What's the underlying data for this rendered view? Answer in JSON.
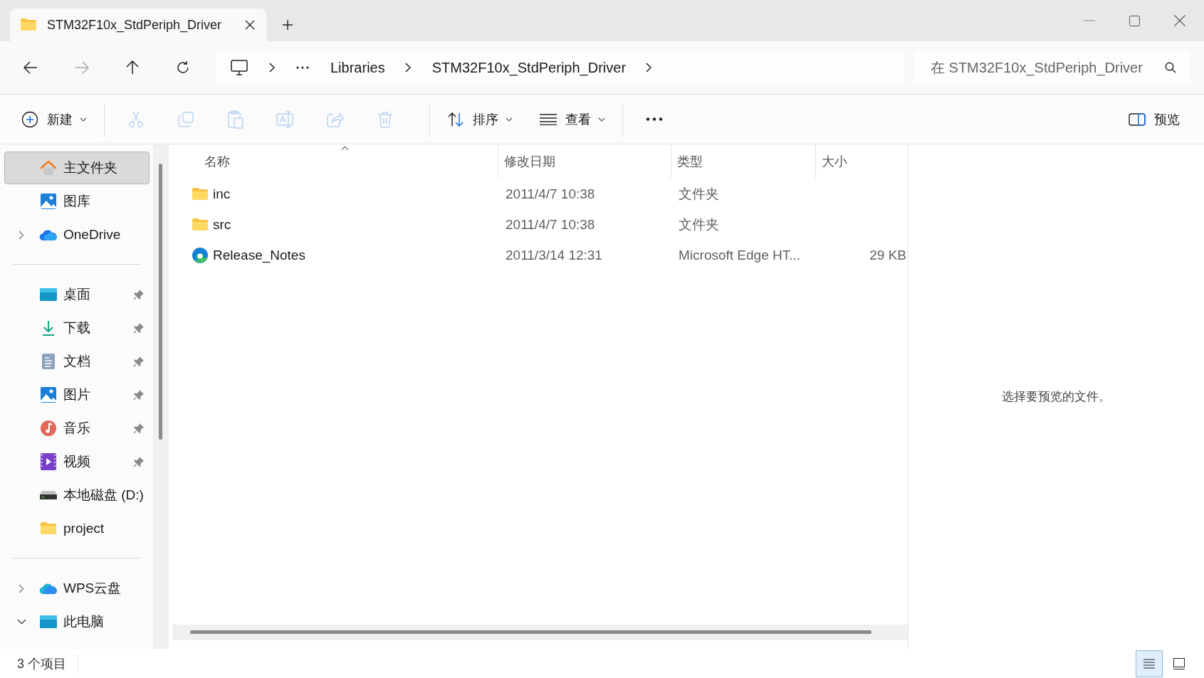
{
  "tabs": [
    {
      "title": "STM32F10x_StdPeriph_Driver",
      "selected": true
    }
  ],
  "address": {
    "segments": [
      "Libraries",
      "STM32F10x_StdPeriph_Driver"
    ]
  },
  "search": {
    "placeholder": "在 STM32F10x_StdPeriph_Driver"
  },
  "toolbar": [
    {
      "kind": "new",
      "label": "新建",
      "disabled": false
    },
    {
      "kind": "cut",
      "disabled": true
    },
    {
      "kind": "copy",
      "disabled": true
    },
    {
      "kind": "paste",
      "disabled": true
    },
    {
      "kind": "rename",
      "disabled": true
    },
    {
      "kind": "share",
      "disabled": true
    },
    {
      "kind": "delete",
      "disabled": true
    },
    {
      "kind": "sort",
      "label": "排序",
      "disabled": false
    },
    {
      "kind": "view",
      "label": "查看",
      "disabled": false
    },
    {
      "kind": "more",
      "disabled": false
    }
  ],
  "preview_button": {
    "label": "预览"
  },
  "sidebar": {
    "groups": [
      [
        {
          "label": "主文件夹",
          "kind": "home",
          "selected": true
        },
        {
          "label": "图库",
          "kind": "gallery",
          "selected": false
        },
        {
          "label": "OneDrive",
          "kind": "cloud",
          "selected": false,
          "expanded": false
        }
      ],
      [
        {
          "label": "桌面",
          "kind": "desktop",
          "selected": false,
          "pinned": true
        },
        {
          "label": "下载",
          "kind": "download",
          "selected": false,
          "pinned": true
        },
        {
          "label": "文档",
          "kind": "document",
          "selected": false,
          "pinned": true
        },
        {
          "label": "图片",
          "kind": "gallery",
          "selected": false,
          "pinned": true
        },
        {
          "label": "音乐",
          "kind": "music",
          "selected": false,
          "pinned": true
        },
        {
          "label": "视频",
          "kind": "video",
          "selected": false,
          "pinned": true
        },
        {
          "label": "本地磁盘 (D:)",
          "kind": "drive",
          "selected": false,
          "pinned": false
        },
        {
          "label": "project",
          "kind": "folder",
          "selected": false,
          "pinned": false
        }
      ],
      [
        {
          "label": "WPS云盘",
          "kind": "cloud2",
          "selected": false,
          "expanded": false
        },
        {
          "label": "此电脑",
          "kind": "desktop",
          "selected": false,
          "expanded": true
        }
      ]
    ]
  },
  "table": {
    "columns": [
      {
        "label": "名称",
        "sorted": true
      },
      {
        "label": "修改日期",
        "sorted": false
      },
      {
        "label": "类型",
        "sorted": false
      },
      {
        "label": "大小",
        "sorted": false
      }
    ],
    "rows": [
      {
        "kind": "folder",
        "name": "inc",
        "date": "2011/4/7 10:38",
        "type": "文件夹",
        "selected": false
      },
      {
        "kind": "folder",
        "name": "src",
        "date": "2011/4/7 10:38",
        "type": "文件夹",
        "selected": false
      },
      {
        "kind": "edge",
        "name": "Release_Notes",
        "date": "2011/3/14 12:31",
        "type": "Microsoft Edge HT...",
        "size": "29 KB",
        "selected": false
      }
    ]
  },
  "preview_pane": {
    "message": "选择要预览的文件。"
  },
  "status_bar": {
    "count": "3 个项目",
    "views": [
      {
        "kind": "details",
        "selected": true
      },
      {
        "kind": "tiles",
        "selected": false
      }
    ]
  }
}
